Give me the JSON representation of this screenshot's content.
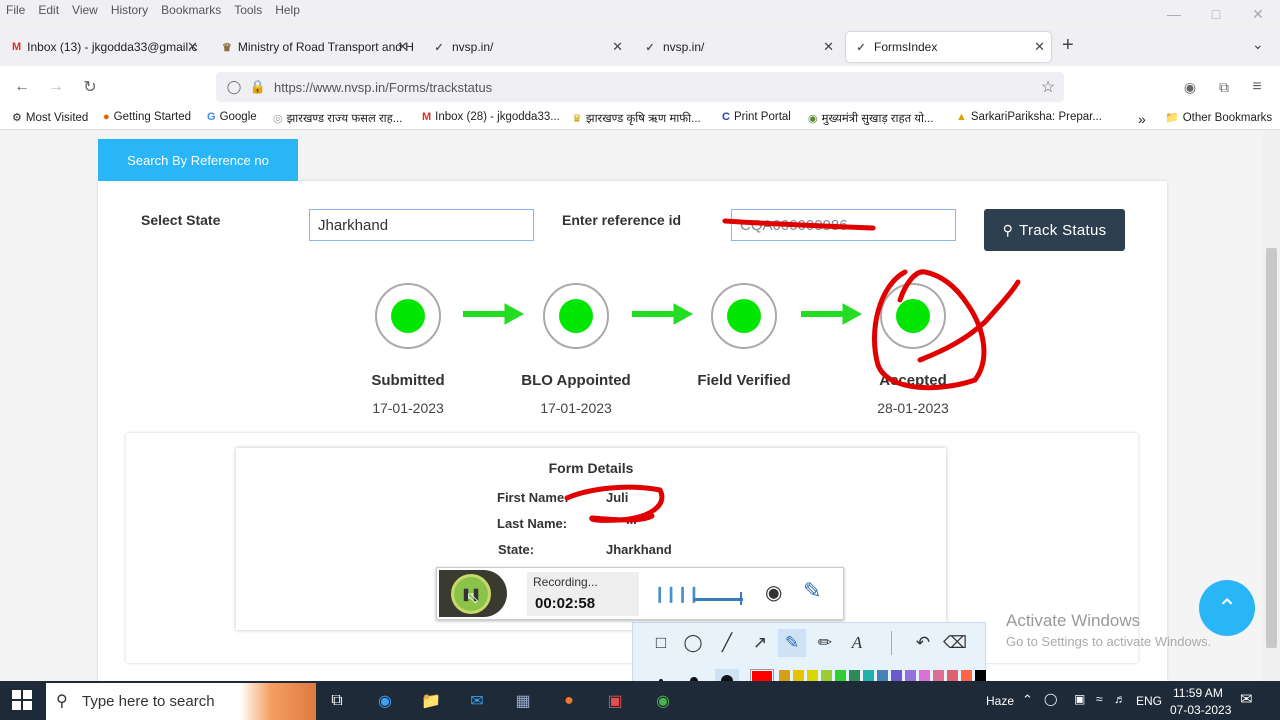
{
  "menu": [
    "File",
    "Edit",
    "View",
    "History",
    "Bookmarks",
    "Tools",
    "Help"
  ],
  "tabs": [
    {
      "label": "Inbox (13) - jkgodda33@gmail.c",
      "icon": "gmail-icon"
    },
    {
      "label": "Ministry of Road Transport and H",
      "icon": "emblem-icon"
    },
    {
      "label": "nvsp.in/",
      "icon": "nvsp-icon"
    },
    {
      "label": "nvsp.in/",
      "icon": "nvsp-icon"
    },
    {
      "label": "FormsIndex",
      "icon": "nvsp-icon"
    }
  ],
  "url": "https://www.nvsp.in/Forms/trackstatus",
  "bookmarks": [
    "Most Visited",
    "Getting Started",
    "Google",
    "झारखण्ड राज्य फसल राह...",
    "Inbox (28) - jkgodda33...",
    "झारखण्ड कृषि ऋण माफी...",
    "Print Portal",
    "मुख्यमंत्री सुखाड़ राहत यो...",
    "SarkariPariksha: Prepar...",
    "Other Bookmarks"
  ],
  "page": {
    "search_tab": "Search By Reference no",
    "select_state_label": "Select State",
    "state_value": "Jharkhand",
    "ref_label": "Enter reference id",
    "ref_value": "CQA000000086",
    "track_button": "Track Status",
    "steps": [
      {
        "label": "Submitted",
        "date": "17-01-2023"
      },
      {
        "label": "BLO Appointed",
        "date": "17-01-2023"
      },
      {
        "label": "Field Verified",
        "date": ""
      },
      {
        "label": "Accepted",
        "date": "28-01-2023"
      }
    ],
    "form_details": {
      "title": "Form Details",
      "first_name_label": "First Name:",
      "first_name": "Juli",
      "last_name_label": "Last Name:",
      "last_name": "...",
      "state_label": "State:",
      "state": "Jharkhand"
    }
  },
  "recorder": {
    "status": "Recording...",
    "time": "00:02:58"
  },
  "watermark": {
    "title": "Activate Windows",
    "subtitle": "Go to Settings to activate Windows."
  },
  "taskbar": {
    "search_placeholder": "Type here to search",
    "weather": "Haze",
    "lang": "ENG",
    "time": "11:59 AM",
    "date": "07-03-2023"
  },
  "colors": {
    "accent": "#29b6f6",
    "step_green": "#00e600",
    "annotation_red": "#e00000",
    "button_dark": "#2e3f4f"
  }
}
